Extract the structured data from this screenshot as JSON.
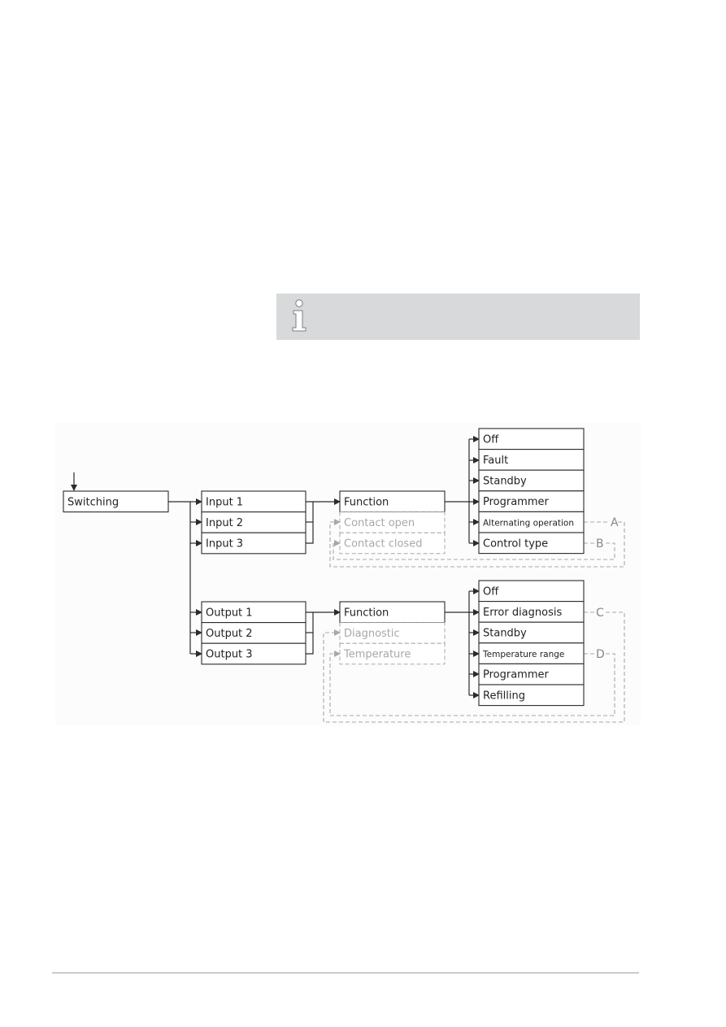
{
  "info_note": {
    "icon": "info-icon",
    "text": ""
  },
  "diagram": {
    "root": "Switching",
    "inputs": {
      "items": [
        "Input 1",
        "Input 2",
        "Input 3"
      ],
      "function_group": {
        "active": "Function",
        "inactive": [
          "Contact open",
          "Contact closed"
        ]
      },
      "options": [
        "Off",
        "Fault",
        "Standby",
        "Programmer",
        "Alternating operation",
        "Control type"
      ],
      "references": [
        {
          "label": "A",
          "from": "Alternating operation",
          "to": "Contact open"
        },
        {
          "label": "B",
          "from": "Control type",
          "to": "Contact closed"
        }
      ]
    },
    "outputs": {
      "items": [
        "Output 1",
        "Output 2",
        "Output 3"
      ],
      "function_group": {
        "active": "Function",
        "inactive": [
          "Diagnostic",
          "Temperature"
        ]
      },
      "options": [
        "Off",
        "Error diagnosis",
        "Standby",
        "Temperature range",
        "Programmer",
        "Refilling"
      ],
      "references": [
        {
          "label": "C",
          "from": "Error diagnosis",
          "to": "Diagnostic"
        },
        {
          "label": "D",
          "from": "Temperature range",
          "to": "Temperature"
        }
      ]
    },
    "colors": {
      "line": "#2b2b2b",
      "ghost": "#a8a8a8",
      "info_bg": "#d7d9da"
    }
  }
}
